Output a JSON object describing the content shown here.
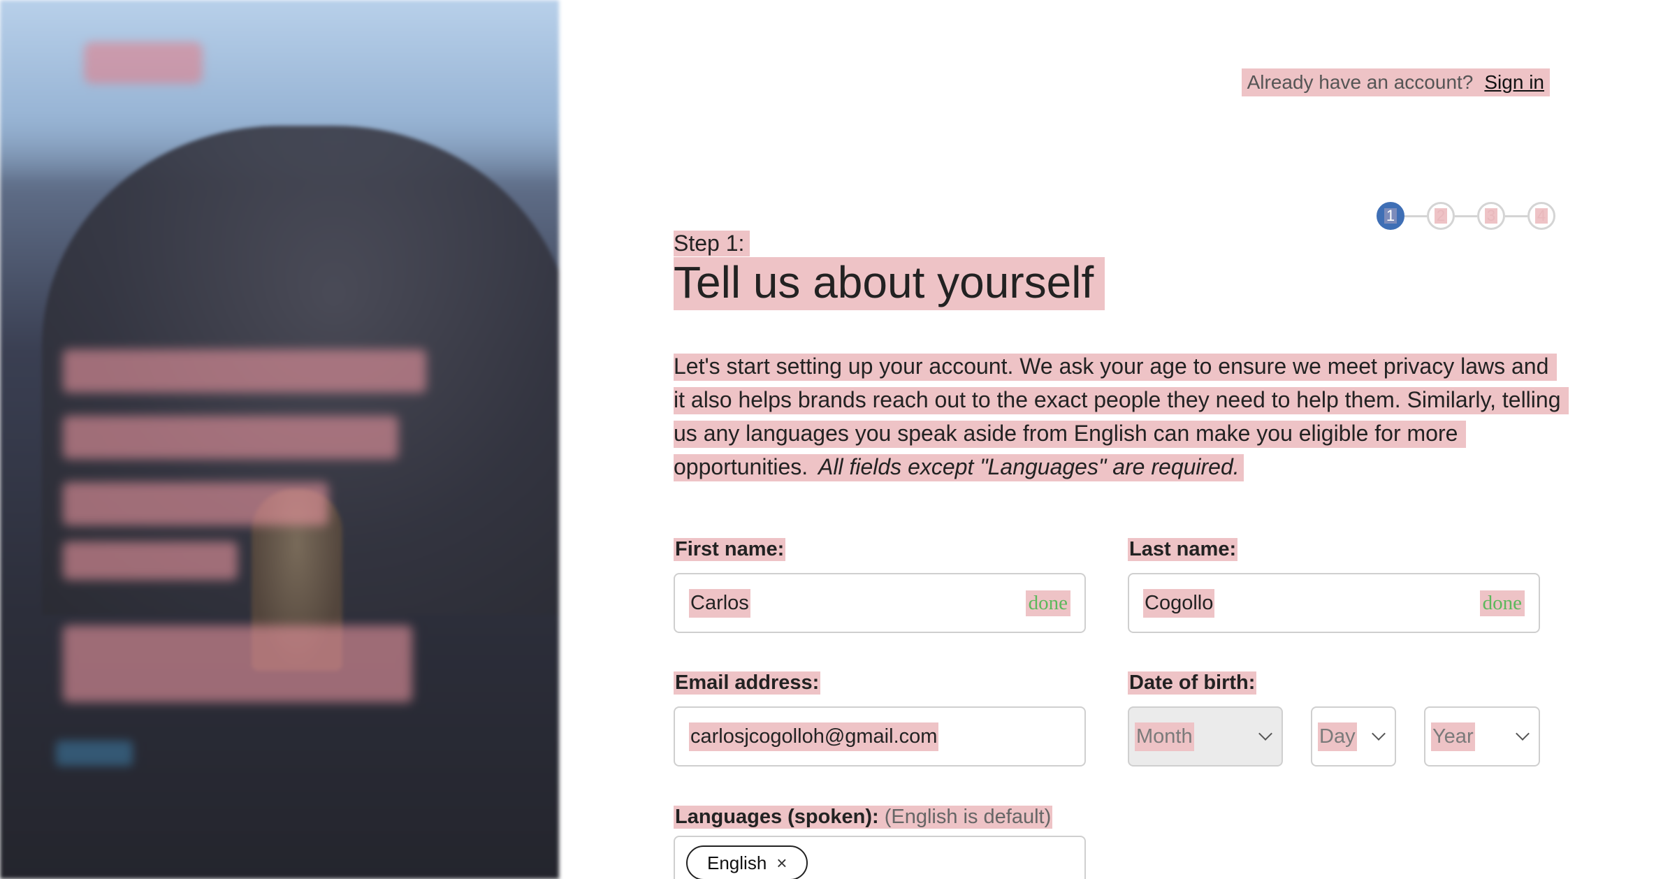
{
  "header": {
    "prompt": "Already have an account?",
    "signin_label": "Sign in"
  },
  "stepper": {
    "steps": [
      "1",
      "2",
      "3",
      "4"
    ],
    "current": 1,
    "active_color": "#3f6fb5"
  },
  "main": {
    "step_label": "Step 1:",
    "title": "Tell us about yourself",
    "intro": "Let's start setting up your account. We ask your age to ensure we meet privacy laws and it also helps brands reach out to the exact people they need to help them. Similarly, telling us any languages you speak aside from English can make you eligible for more opportunities.",
    "intro_note": "All fields except \"Languages\" are required."
  },
  "form": {
    "first_name": {
      "label": "First name:",
      "value": "Carlos",
      "status": "done"
    },
    "last_name": {
      "label": "Last name:",
      "value": "Cogollo",
      "status": "done"
    },
    "email": {
      "label": "Email address:",
      "value": "carlosjcogolloh@gmail.com"
    },
    "dob": {
      "label": "Date of birth:",
      "month_placeholder": "Month",
      "day_placeholder": "Day",
      "year_placeholder": "Year"
    },
    "languages": {
      "label": "Languages (spoken):",
      "hint": "(English is default)",
      "chips": [
        "English"
      ],
      "remove_glyph": "×"
    }
  },
  "colors": {
    "highlight": "#eec3c6",
    "done_green": "#5cb85c"
  }
}
